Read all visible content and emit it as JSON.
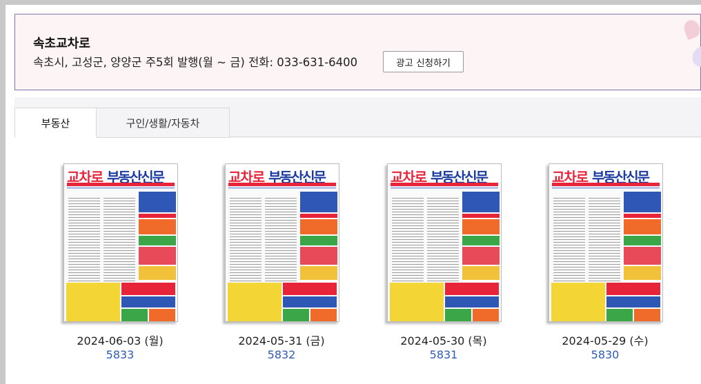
{
  "header": {
    "title": "속초교차로",
    "description": "속초시, 고성군, 양양군 주5회 발행(월 ~ 금) 전화: 033-631-6400",
    "ad_button_label": "광고 신청하기"
  },
  "tabs": [
    {
      "label": "부동산",
      "active": true
    },
    {
      "label": "구인/생활/자동차",
      "active": false
    }
  ],
  "issues": [
    {
      "date": "2024-06-03 (월)",
      "number": "5833",
      "mast_red": "교차로",
      "mast_blue": "부동산신문"
    },
    {
      "date": "2024-05-31 (금)",
      "number": "5832",
      "mast_red": "교차로",
      "mast_blue": "부동산신문"
    },
    {
      "date": "2024-05-30 (목)",
      "number": "5831",
      "mast_red": "교차로",
      "mast_blue": "부동산신문"
    },
    {
      "date": "2024-05-29 (수)",
      "number": "5830",
      "mast_red": "교차로",
      "mast_blue": "부동산신문"
    }
  ],
  "colors": {
    "header_bg": "#fdf4f6",
    "header_border": "#8a6fb0",
    "link": "#2f5cb0",
    "mast_red": "#e8243a",
    "mast_blue": "#1a3aa0"
  }
}
